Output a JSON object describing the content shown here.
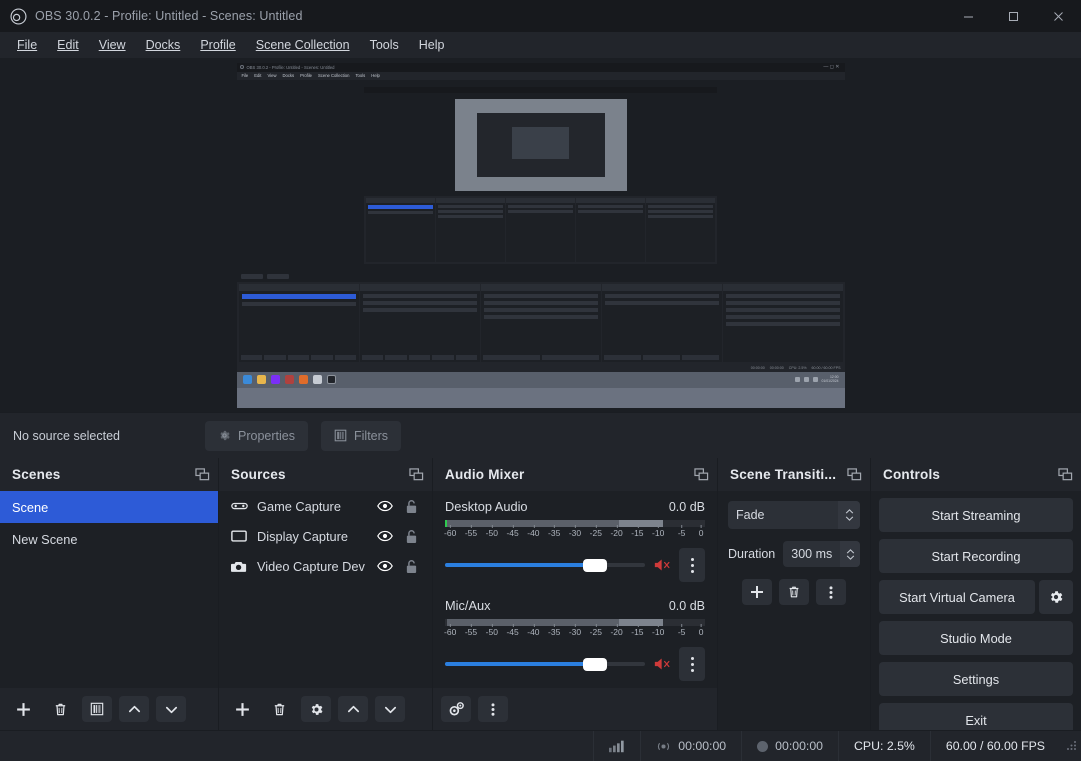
{
  "window": {
    "title": "OBS 30.0.2 - Profile: Untitled - Scenes: Untitled",
    "logo_icon": "obs-logo-icon",
    "minimize_label": "—",
    "maximize_label": "□",
    "close_label": "✕"
  },
  "menubar": {
    "items": [
      {
        "label": "File",
        "mnemonic": "F"
      },
      {
        "label": "Edit",
        "mnemonic": "E"
      },
      {
        "label": "View",
        "mnemonic": "V"
      },
      {
        "label": "Docks",
        "mnemonic": "D"
      },
      {
        "label": "Profile",
        "mnemonic": "P"
      },
      {
        "label": "Scene Collection",
        "mnemonic": "S"
      },
      {
        "label": "Tools",
        "mnemonic": "T"
      },
      {
        "label": "Help",
        "mnemonic": "H"
      }
    ]
  },
  "preview": {
    "description": "OBS preview showing a recursive capture of the OBS window itself",
    "nested": {
      "title": "OBS 30.0.2 - Profile: Untitled - Scenes: Untitled",
      "menu": [
        "File",
        "Edit",
        "View",
        "Docks",
        "Profile",
        "Scene Collection",
        "Tools",
        "Help"
      ],
      "source_toolbar": "No source selected",
      "properties_label": "Properties",
      "filters_label": "Filters",
      "status": [
        "00:00:00",
        "00:00:00",
        "CPU: 2.5%",
        "60.00 / 60.00 FPS"
      ]
    }
  },
  "source_toolbar": {
    "status_text": "No source selected",
    "properties_label": "Properties",
    "properties_icon": "gear-icon",
    "filters_label": "Filters",
    "filters_icon": "filters-icon"
  },
  "scenes": {
    "title": "Scenes",
    "float_icon": "undock-icon",
    "items": [
      {
        "label": "Scene",
        "selected": true
      },
      {
        "label": "New Scene",
        "selected": false
      }
    ],
    "tools": [
      {
        "name": "add-scene",
        "icon": "plus-icon"
      },
      {
        "name": "remove-scene",
        "icon": "trash-icon"
      },
      {
        "name": "scene-filters",
        "icon": "filters-icon"
      },
      {
        "name": "move-scene-up",
        "icon": "chevron-up-icon"
      },
      {
        "name": "move-scene-down",
        "icon": "chevron-down-icon"
      }
    ]
  },
  "sources": {
    "title": "Sources",
    "float_icon": "undock-icon",
    "items": [
      {
        "label": "Game Capture",
        "icon": "gamepad-icon",
        "visible": true,
        "locked": false
      },
      {
        "label": "Display Capture",
        "icon": "monitor-icon",
        "visible": true,
        "locked": false
      },
      {
        "label": "Video Capture Dev",
        "icon": "camera-icon",
        "visible": true,
        "locked": false
      }
    ],
    "tools": [
      {
        "name": "add-source",
        "icon": "plus-icon"
      },
      {
        "name": "remove-source",
        "icon": "trash-icon"
      },
      {
        "name": "source-properties",
        "icon": "gear-icon"
      },
      {
        "name": "move-source-up",
        "icon": "chevron-up-icon"
      },
      {
        "name": "move-source-down",
        "icon": "chevron-down-icon"
      }
    ]
  },
  "audio_mixer": {
    "title": "Audio Mixer",
    "float_icon": "undock-icon",
    "scale_ticks": [
      "-60",
      "-55",
      "-50",
      "-45",
      "-40",
      "-35",
      "-30",
      "-25",
      "-20",
      "-15",
      "-10",
      "-5",
      "0"
    ],
    "channels": [
      {
        "name": "Desktop Audio",
        "db": "0.0 dB",
        "volume_percent": 74,
        "muted": true,
        "mute_icon": "speaker-muted-icon",
        "menu_icon": "vertical-dots-icon"
      },
      {
        "name": "Mic/Aux",
        "db": "0.0 dB",
        "volume_percent": 74,
        "muted": true,
        "mute_icon": "speaker-muted-icon",
        "menu_icon": "vertical-dots-icon"
      }
    ],
    "tools": [
      {
        "name": "advanced-audio-properties",
        "icon": "double-gear-icon"
      },
      {
        "name": "mixer-menu",
        "icon": "vertical-dots-icon"
      }
    ]
  },
  "scene_transitions": {
    "title": "Scene Transiti...",
    "float_icon": "undock-icon",
    "transition": "Fade",
    "duration_label": "Duration",
    "duration_value": "300 ms",
    "tools": [
      {
        "name": "add-transition",
        "icon": "plus-icon"
      },
      {
        "name": "remove-transition",
        "icon": "trash-icon"
      },
      {
        "name": "transition-menu",
        "icon": "vertical-dots-icon"
      }
    ]
  },
  "controls": {
    "title": "Controls",
    "float_icon": "undock-icon",
    "buttons": [
      {
        "label": "Start Streaming",
        "name": "start-streaming-button"
      },
      {
        "label": "Start Recording",
        "name": "start-recording-button"
      },
      {
        "label": "Start Virtual Camera",
        "name": "start-virtual-camera-button"
      },
      {
        "label": "Studio Mode",
        "name": "studio-mode-button"
      },
      {
        "label": "Settings",
        "name": "settings-button"
      },
      {
        "label": "Exit",
        "name": "exit-button"
      }
    ],
    "virtual_camera_config_icon": "gear-icon"
  },
  "statusbar": {
    "signal_icon": "signal-bars-icon",
    "stream_icon": "broadcast-icon",
    "stream_time": "00:00:00",
    "record_icon": "record-dot-icon",
    "record_time": "00:00:00",
    "cpu": "CPU: 2.5%",
    "fps": "60.00 / 60.00 FPS",
    "grip_icon": "resize-grip-icon"
  },
  "colors": {
    "accent_blue": "#2d5bd7",
    "slider_blue": "#2b7fe0",
    "mute_red": "#cf3a3a",
    "meter_green": "#2ecb4f",
    "panel_bg": "#22252b",
    "list_bg": "#1d2025",
    "titlebar_bg": "#17191d"
  }
}
